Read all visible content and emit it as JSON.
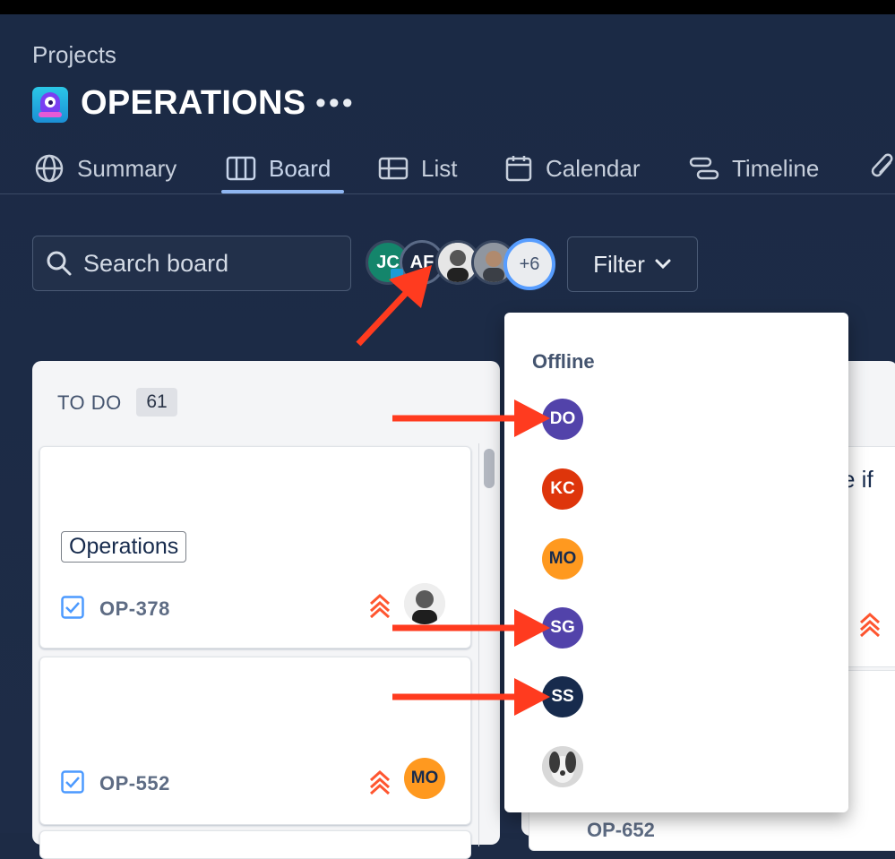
{
  "header": {
    "breadcrumb": "Projects",
    "title": "OPERATIONS",
    "more_label": "•••"
  },
  "tabs": [
    {
      "label": "Summary",
      "icon": "globe-icon"
    },
    {
      "label": "Board",
      "icon": "board-icon",
      "active": true
    },
    {
      "label": "List",
      "icon": "list-icon"
    },
    {
      "label": "Calendar",
      "icon": "calendar-icon"
    },
    {
      "label": "Timeline",
      "icon": "timeline-icon"
    }
  ],
  "toolbar": {
    "search_placeholder": "Search board",
    "avatars": [
      {
        "initials": "JC",
        "color": "#14856b"
      },
      {
        "initials": "AF",
        "color": "#1f2b44"
      },
      {
        "initials": "",
        "kind": "photo"
      },
      {
        "initials": "",
        "kind": "photo"
      }
    ],
    "more_count": "+6",
    "filter_label": "Filter"
  },
  "column_todo": {
    "title": "TO DO",
    "count": "61",
    "cards": [
      {
        "label": "Operations",
        "key": "OP-378",
        "priority": "highest",
        "assignee": "photo"
      },
      {
        "key": "OP-552",
        "priority": "highest",
        "assignee_initials": "MO",
        "assignee_color": "#ff991f"
      }
    ]
  },
  "column_next": {
    "partial_text": "e if",
    "partial_key": "OP-652"
  },
  "offline_dropdown": {
    "heading": "Offline",
    "users": [
      {
        "initials": "DO",
        "color": "#5243aa"
      },
      {
        "initials": "KC",
        "color": "#de350b"
      },
      {
        "initials": "MO",
        "color": "#ff991f"
      },
      {
        "initials": "SG",
        "color": "#5243aa"
      },
      {
        "initials": "SS",
        "color": "#172b4d"
      },
      {
        "initials": "",
        "kind": "photo"
      }
    ]
  },
  "colors": {
    "background": "#1d2b45",
    "accent": "#579dff",
    "annotation_arrow": "#ff3b1f",
    "priority": "#ff5630"
  }
}
